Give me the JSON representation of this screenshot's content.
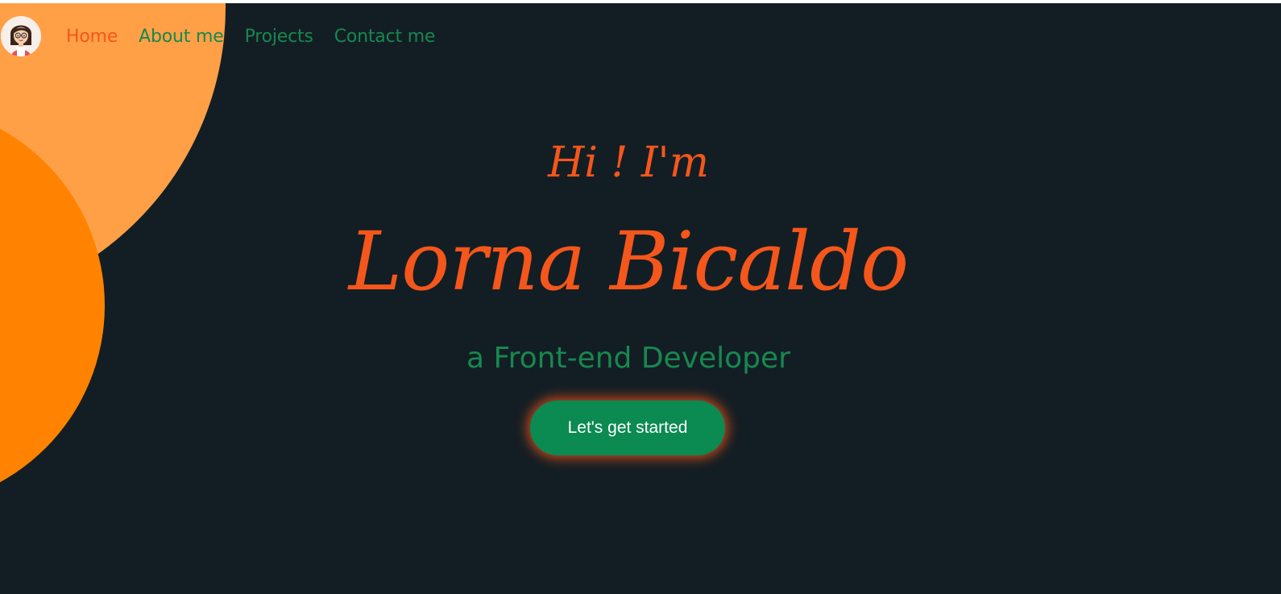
{
  "nav": {
    "avatar_icon": "avatar-icon",
    "items": [
      {
        "label": "Home",
        "active": true
      },
      {
        "label": "About me",
        "active": false
      },
      {
        "label": "Projects",
        "active": false
      },
      {
        "label": "Contact me",
        "active": false
      }
    ]
  },
  "hero": {
    "greeting": "Hi ! I'm",
    "name": "Lorna Bicaldo",
    "role": "a Front-end Developer",
    "cta_label": "Let's get started"
  },
  "colors": {
    "background": "#131e24",
    "accent_orange": "#f5561b",
    "accent_green": "#17884f",
    "circle_outer": "#ffa047",
    "circle_inner": "#ff8300",
    "button": "#0b8a52"
  }
}
